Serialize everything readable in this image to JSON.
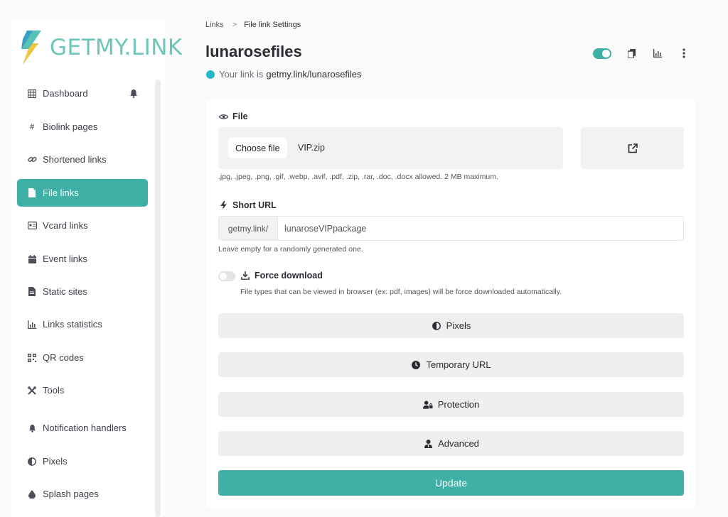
{
  "brand": {
    "name": "GETMY.LINK",
    "accent": "#3fb0a5"
  },
  "sidebar": {
    "items": [
      {
        "label": "Dashboard",
        "icon": "grid-icon"
      },
      {
        "label": "Biolink pages",
        "icon": "hash-icon"
      },
      {
        "label": "Shortened links",
        "icon": "link-icon"
      },
      {
        "label": "File links",
        "icon": "file-icon",
        "active": true
      },
      {
        "label": "Vcard links",
        "icon": "id-card-icon"
      },
      {
        "label": "Event links",
        "icon": "calendar-icon"
      },
      {
        "label": "Static sites",
        "icon": "document-icon"
      },
      {
        "label": "Links statistics",
        "icon": "chart-icon"
      },
      {
        "label": "QR codes",
        "icon": "qr-code-icon"
      },
      {
        "label": "Tools",
        "icon": "tools-icon"
      },
      {
        "label": "Notification handlers",
        "icon": "bell-icon"
      },
      {
        "label": "Pixels",
        "icon": "adjust-icon"
      },
      {
        "label": "Splash pages",
        "icon": "droplet-icon"
      }
    ]
  },
  "breadcrumb": {
    "parent": "Links",
    "separator": ">",
    "current": "File link Settings"
  },
  "page": {
    "title": "lunarosefiles",
    "link_prefix": "Your link is",
    "link_url": "getmy.link/lunarosefiles"
  },
  "form": {
    "file": {
      "label": "File",
      "choose_button": "Choose file",
      "file_name": "VIP.zip",
      "help": ".jpg, .jpeg, .png, .gif, .webp, .avif, .pdf, .zip, .rar, .doc, .docx allowed. 2 MB maximum."
    },
    "short_url": {
      "label": "Short URL",
      "prefix": "getmy.link/",
      "value": "lunaroseVIPpackage",
      "help": "Leave empty for a randomly generated one."
    },
    "force_download": {
      "label": "Force download",
      "help": "File types that can be viewed in browser (ex: pdf, images) will be force downloaded automatically."
    },
    "sections": [
      {
        "label": "Pixels",
        "icon": "adjust-icon"
      },
      {
        "label": "Temporary URL",
        "icon": "clock-icon"
      },
      {
        "label": "Protection",
        "icon": "user-lock-icon"
      },
      {
        "label": "Advanced",
        "icon": "user-tie-icon"
      }
    ],
    "update_button": "Update"
  }
}
